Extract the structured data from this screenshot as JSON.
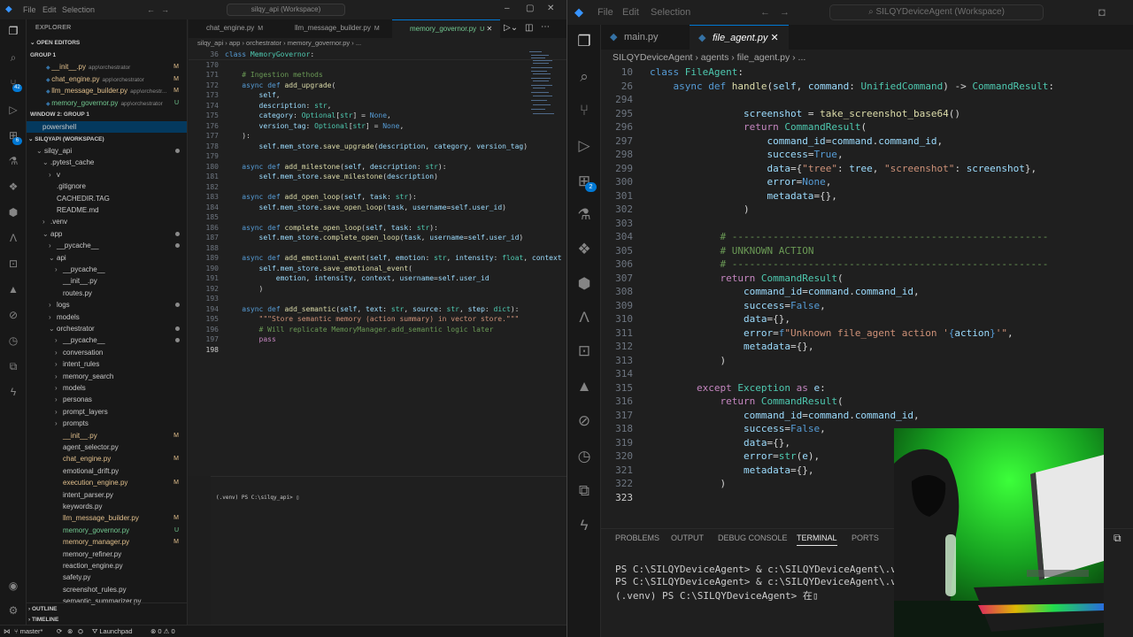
{
  "left_window": {
    "menu": [
      "File",
      "Edit",
      "Selection"
    ],
    "title": "silqy_api (Workspace)",
    "sidebar": {
      "title": "EXPLORER",
      "open_editors": "OPEN EDITORS",
      "group1": "GROUP 1",
      "open_files": [
        {
          "name": "__init__.py",
          "path": "app\\orchestrator",
          "status": "M"
        },
        {
          "name": "chat_engine.py",
          "path": "app\\orchestrator",
          "status": "M"
        },
        {
          "name": "llm_message_builder.py",
          "path": "app\\orchestr...",
          "status": "M"
        },
        {
          "name": "memory_governor.py",
          "path": "app\\orchestrator",
          "status": "U"
        }
      ],
      "window2": "WINDOW 2: GROUP 1",
      "powershell": "powershell",
      "workspace": "SILQYAPI (WORKSPACE)",
      "tree": [
        {
          "name": "silqy_api",
          "indent": 1,
          "arrow": "⌄",
          "dot": true
        },
        {
          "name": ".pytest_cache",
          "indent": 2,
          "arrow": "⌄"
        },
        {
          "name": "v",
          "indent": 3,
          "arrow": "›"
        },
        {
          "name": ".gitignore",
          "indent": 3
        },
        {
          "name": "CACHEDIR.TAG",
          "indent": 3
        },
        {
          "name": "README.md",
          "indent": 3
        },
        {
          "name": ".venv",
          "indent": 2,
          "arrow": "›"
        },
        {
          "name": "app",
          "indent": 2,
          "arrow": "⌄",
          "dot": true
        },
        {
          "name": "__pycache__",
          "indent": 3,
          "arrow": "›",
          "dot": true
        },
        {
          "name": "api",
          "indent": 3,
          "arrow": "⌄"
        },
        {
          "name": "__pycache__",
          "indent": 4,
          "arrow": "›"
        },
        {
          "name": "__init__.py",
          "indent": 4
        },
        {
          "name": "routes.py",
          "indent": 4
        },
        {
          "name": "logs",
          "indent": 3,
          "arrow": "›",
          "dot": true
        },
        {
          "name": "models",
          "indent": 3,
          "arrow": "›"
        },
        {
          "name": "orchestrator",
          "indent": 3,
          "arrow": "⌄",
          "dot": true
        },
        {
          "name": "__pycache__",
          "indent": 4,
          "arrow": "›",
          "dot": true
        },
        {
          "name": "conversation",
          "indent": 4,
          "arrow": "›"
        },
        {
          "name": "intent_rules",
          "indent": 4,
          "arrow": "›"
        },
        {
          "name": "memory_search",
          "indent": 4,
          "arrow": "›"
        },
        {
          "name": "models",
          "indent": 4,
          "arrow": "›"
        },
        {
          "name": "personas",
          "indent": 4,
          "arrow": "›"
        },
        {
          "name": "prompt_layers",
          "indent": 4,
          "arrow": "›"
        },
        {
          "name": "prompts",
          "indent": 4,
          "arrow": "›"
        },
        {
          "name": "__init__.py",
          "indent": 4,
          "status": "M"
        },
        {
          "name": "agent_selector.py",
          "indent": 4
        },
        {
          "name": "chat_engine.py",
          "indent": 4,
          "status": "M"
        },
        {
          "name": "emotional_drift.py",
          "indent": 4
        },
        {
          "name": "execution_engine.py",
          "indent": 4,
          "status": "M"
        },
        {
          "name": "intent_parser.py",
          "indent": 4
        },
        {
          "name": "keywords.py",
          "indent": 4
        },
        {
          "name": "llm_message_builder.py",
          "indent": 4,
          "status": "M"
        },
        {
          "name": "memory_governor.py",
          "indent": 4,
          "status": "U"
        },
        {
          "name": "memory_manager.py",
          "indent": 4,
          "status": "M"
        },
        {
          "name": "memory_refiner.py",
          "indent": 4
        },
        {
          "name": "reaction_engine.py",
          "indent": 4
        },
        {
          "name": "safety.py",
          "indent": 4
        },
        {
          "name": "screenshot_rules.py",
          "indent": 4
        },
        {
          "name": "semantic_summarizer.py",
          "indent": 4
        }
      ],
      "outline": "OUTLINE",
      "timeline": "TIMELINE"
    },
    "tabs": [
      {
        "name": "chat_engine.py",
        "mark": "M"
      },
      {
        "name": "llm_message_builder.py",
        "mark": "M"
      },
      {
        "name": "memory_governor.py",
        "mark": "U"
      }
    ],
    "breadcrumb": "silqy_api › app › orchestrator › memory_governor.py › ...",
    "code": [
      [
        "36",
        "<span class=\"kw\">class</span> <span class=\"cls\">MemoryGovernor</span>:"
      ],
      [
        "170",
        ""
      ],
      [
        "171",
        "    <span class=\"cm\"># Ingestion methods</span>"
      ],
      [
        "172",
        "    <span class=\"kw\">async</span> <span class=\"kw\">def</span> <span class=\"fn\">add_upgrade</span>("
      ],
      [
        "173",
        "        <span class=\"pm\">self</span>,"
      ],
      [
        "174",
        "        <span class=\"pm\">description</span>: <span class=\"cls\">str</span>,"
      ],
      [
        "175",
        "        <span class=\"pm\">category</span>: <span class=\"cls\">Optional</span>[<span class=\"cls\">str</span>] = <span class=\"kc\">None</span>,"
      ],
      [
        "176",
        "        <span class=\"pm\">version_tag</span>: <span class=\"cls\">Optional</span>[<span class=\"cls\">str</span>] = <span class=\"kc\">None</span>,"
      ],
      [
        "177",
        "    ):"
      ],
      [
        "178",
        "        <span class=\"pm\">self</span>.<span class=\"pm\">mem_store</span>.<span class=\"fn\">save_upgrade</span>(<span class=\"pm\">description</span>, <span class=\"pm\">category</span>, <span class=\"pm\">version_tag</span>)"
      ],
      [
        "179",
        ""
      ],
      [
        "180",
        "    <span class=\"kw\">async</span> <span class=\"kw\">def</span> <span class=\"fn\">add_milestone</span>(<span class=\"pm\">self</span>, <span class=\"pm\">description</span>: <span class=\"cls\">str</span>):"
      ],
      [
        "181",
        "        <span class=\"pm\">self</span>.<span class=\"pm\">mem_store</span>.<span class=\"fn\">save_milestone</span>(<span class=\"pm\">description</span>)"
      ],
      [
        "182",
        ""
      ],
      [
        "183",
        "    <span class=\"kw\">async</span> <span class=\"kw\">def</span> <span class=\"fn\">add_open_loop</span>(<span class=\"pm\">self</span>, <span class=\"pm\">task</span>: <span class=\"cls\">str</span>):"
      ],
      [
        "184",
        "        <span class=\"pm\">self</span>.<span class=\"pm\">mem_store</span>.<span class=\"fn\">save_open_loop</span>(<span class=\"pm\">task</span>, <span class=\"pm\">username</span>=<span class=\"pm\">self</span>.<span class=\"pm\">user_id</span>)"
      ],
      [
        "185",
        ""
      ],
      [
        "186",
        "    <span class=\"kw\">async</span> <span class=\"kw\">def</span> <span class=\"fn\">complete_open_loop</span>(<span class=\"pm\">self</span>, <span class=\"pm\">task</span>: <span class=\"cls\">str</span>):"
      ],
      [
        "187",
        "        <span class=\"pm\">self</span>.<span class=\"pm\">mem_store</span>.<span class=\"fn\">complete_open_loop</span>(<span class=\"pm\">task</span>, <span class=\"pm\">username</span>=<span class=\"pm\">self</span>.<span class=\"pm\">user_id</span>)"
      ],
      [
        "188",
        ""
      ],
      [
        "189",
        "    <span class=\"kw\">async</span> <span class=\"kw\">def</span> <span class=\"fn\">add_emotional_event</span>(<span class=\"pm\">self</span>, <span class=\"pm\">emotion</span>: <span class=\"cls\">str</span>, <span class=\"pm\">intensity</span>: <span class=\"cls\">float</span>, <span class=\"pm\">context</span>"
      ],
      [
        "190",
        "        <span class=\"pm\">self</span>.<span class=\"pm\">mem_store</span>.<span class=\"fn\">save_emotional_event</span>("
      ],
      [
        "191",
        "            <span class=\"pm\">emotion</span>, <span class=\"pm\">intensity</span>, <span class=\"pm\">context</span>, <span class=\"pm\">username</span>=<span class=\"pm\">self</span>.<span class=\"pm\">user_id</span>"
      ],
      [
        "192",
        "        )"
      ],
      [
        "193",
        ""
      ],
      [
        "194",
        "    <span class=\"kw\">async</span> <span class=\"kw\">def</span> <span class=\"fn\">add_semantic</span>(<span class=\"pm\">self</span>, <span class=\"pm\">text</span>: <span class=\"cls\">str</span>, <span class=\"pm\">source</span>: <span class=\"cls\">str</span>, <span class=\"pm\">step</span>: <span class=\"cls\">dict</span>):"
      ],
      [
        "195",
        "        <span class=\"str\">\"\"\"Store semantic memory (action summary) in vector store.\"\"\"</span>"
      ],
      [
        "196",
        "        <span class=\"cm\"># Will replicate MemoryManager.add_semantic logic later</span>"
      ],
      [
        "197",
        "        <span class=\"ctl\">pass</span>"
      ],
      [
        "198",
        ""
      ]
    ],
    "terminal_prompt": "(.venv) PS C:\\silqy_api> ",
    "status": {
      "branch": "master*",
      "launch": "Launchpad",
      "errors": "0",
      "warnings": "0"
    }
  },
  "right_window": {
    "menu": [
      "File",
      "Edit",
      "Selection"
    ],
    "title": "SILQYDeviceAgent (Workspace)",
    "tabs": [
      {
        "name": "main.py",
        "active": false
      },
      {
        "name": "file_agent.py",
        "active": true
      }
    ],
    "breadcrumb": "SILQYDeviceAgent › agents › file_agent.py › ...",
    "code": [
      [
        "10",
        "<span class=\"kw\">class</span> <span class=\"cls\">FileAgent</span>:"
      ],
      [
        "26",
        "    <span class=\"kw\">async</span> <span class=\"kw\">def</span> <span class=\"fn\">handle</span>(<span class=\"pm\">self</span>, <span class=\"pm\">command</span>: <span class=\"cls\">UnifiedCommand</span>) -> <span class=\"cls\">CommandResult</span>:"
      ],
      [
        "294",
        ""
      ],
      [
        "295",
        "                <span class=\"pm\">screenshot</span> = <span class=\"fn\">take_screenshot_base64</span>()"
      ],
      [
        "296",
        "                <span class=\"ctl\">return</span> <span class=\"cls\">CommandResult</span>("
      ],
      [
        "297",
        "                    <span class=\"pm\">command_id</span>=<span class=\"pm\">command</span>.<span class=\"pm\">command_id</span>,"
      ],
      [
        "298",
        "                    <span class=\"pm\">success</span>=<span class=\"kc\">True</span>,"
      ],
      [
        "299",
        "                    <span class=\"pm\">data</span>={<span class=\"str\">\"tree\"</span>: <span class=\"pm\">tree</span>, <span class=\"str\">\"screenshot\"</span>: <span class=\"pm\">screenshot</span>},"
      ],
      [
        "300",
        "                    <span class=\"pm\">error</span>=<span class=\"kc\">None</span>,"
      ],
      [
        "301",
        "                    <span class=\"pm\">metadata</span>={},"
      ],
      [
        "302",
        "                )"
      ],
      [
        "303",
        ""
      ],
      [
        "304",
        "            <span class=\"cm\"># ------------------------------------------------------</span>"
      ],
      [
        "305",
        "            <span class=\"cm\"># UNKNOWN ACTION</span>"
      ],
      [
        "306",
        "            <span class=\"cm\"># ------------------------------------------------------</span>"
      ],
      [
        "307",
        "            <span class=\"ctl\">return</span> <span class=\"cls\">CommandResult</span>("
      ],
      [
        "308",
        "                <span class=\"pm\">command_id</span>=<span class=\"pm\">command</span>.<span class=\"pm\">command_id</span>,"
      ],
      [
        "309",
        "                <span class=\"pm\">success</span>=<span class=\"kc\">False</span>,"
      ],
      [
        "310",
        "                <span class=\"pm\">data</span>={},"
      ],
      [
        "311",
        "                <span class=\"pm\">error</span>=<span class=\"kw\">f</span><span class=\"str\">\"Unknown file_agent action '</span><span class=\"kw\">{</span><span class=\"pm\">action</span><span class=\"kw\">}</span><span class=\"str\">'\"</span>,"
      ],
      [
        "312",
        "                <span class=\"pm\">metadata</span>={},"
      ],
      [
        "313",
        "            )"
      ],
      [
        "314",
        ""
      ],
      [
        "315",
        "        <span class=\"ctl\">except</span> <span class=\"cls\">Exception</span> <span class=\"ctl\">as</span> <span class=\"pm\">e</span>:"
      ],
      [
        "316",
        "            <span class=\"ctl\">return</span> <span class=\"cls\">CommandResult</span>("
      ],
      [
        "317",
        "                <span class=\"pm\">command_id</span>=<span class=\"pm\">command</span>.<span class=\"pm\">command_id</span>,"
      ],
      [
        "318",
        "                <span class=\"pm\">success</span>=<span class=\"kc\">False</span>,"
      ],
      [
        "319",
        "                <span class=\"pm\">data</span>={},"
      ],
      [
        "320",
        "                <span class=\"pm\">error</span>=<span class=\"cls\">str</span>(<span class=\"pm\">e</span>),"
      ],
      [
        "321",
        "                <span class=\"pm\">metadata</span>={},"
      ],
      [
        "322",
        "            )"
      ],
      [
        "323",
        ""
      ]
    ],
    "panel_tabs": [
      "PROBLEMS",
      "OUTPUT",
      "DEBUG CONSOLE",
      "TERMINAL",
      "PORTS"
    ],
    "terminal": [
      "PS C:\\SILQYDeviceAgent> & c:\\SILQYDeviceAgent\\.venv\\S",
      "PS C:\\SILQYDeviceAgent> & c:\\SILQYDeviceAgent\\.venv\\S",
      "(.venv) PS C:\\SILQYDeviceAgent> 在"
    ],
    "badge": "2"
  }
}
